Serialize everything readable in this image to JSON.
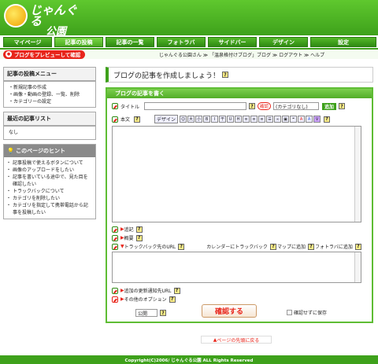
{
  "header": {
    "logo_top": "じゃんぐる",
    "logo_bottom": "公園"
  },
  "nav": {
    "tabs": [
      {
        "label": "マイページ"
      },
      {
        "label": "記事の投稿"
      },
      {
        "label": "記事の一覧"
      },
      {
        "label": "フォトラバ"
      },
      {
        "label": "サイドバー"
      },
      {
        "label": "デザイン"
      },
      {
        "label": "設定"
      }
    ]
  },
  "subbar": {
    "preview_label": "ブログをプレビューして確認",
    "breadcrumb": "じゃんぐる公園さん ≫ 「温泉格付けブログ」ブログ ≫ ログアウト ≫ ヘルプ"
  },
  "sidebar": {
    "post_menu": {
      "title": "記事の投稿メニュー",
      "items": [
        "・新規記事の作成",
        "・画像・動画の登録、一覧、削除",
        "・カテゴリーの設定"
      ]
    },
    "recent": {
      "title": "最近の記事リスト",
      "items": [
        "なし"
      ]
    },
    "hints": {
      "title": "このページのヒント",
      "items": [
        "記事投稿で使えるボタンについて",
        "画像のアップロードをしたい",
        "記事を書いている途中で、見た目を確認したい",
        "トラックバックについて",
        "カテゴリを削除したい",
        "カテゴリを指定して携帯電話から記事を投稿したい"
      ]
    }
  },
  "main": {
    "title": "ブログの記事を作成しましょう！",
    "form_title": "ブログの記事を書く",
    "title_label": "タイトル",
    "title_value": "",
    "confirm_small": "確認",
    "category_value": "(カテゴリなし)",
    "add_label": "追加",
    "body_label": "本文",
    "design_label": "デザイン",
    "toolbar": [
      "大",
      "小",
      "B",
      "I",
      "干",
      "U",
      "H",
      "",
      "",
      "",
      "",
      "",
      "",
      "",
      "A",
      "A",
      "V"
    ],
    "tsuiki": "追記",
    "gaiyou": "概要",
    "trackback_label": "トラックバック先のURL",
    "calendar_tb": "カレンダーにトラックバック",
    "map_add": "マップに追加",
    "photo_add": "フォトラバに追加",
    "update_url": "追加の更新通知先URL",
    "other_options": "その他のオプション",
    "publish_value": "公開",
    "confirm_button": "確認する",
    "save_without_confirm": "確認せずに保存"
  },
  "totop": "ページの先頭に戻る",
  "footer": "Copyright(C)2006/ じゃんぐる公園 ALL Rights Reserved"
}
